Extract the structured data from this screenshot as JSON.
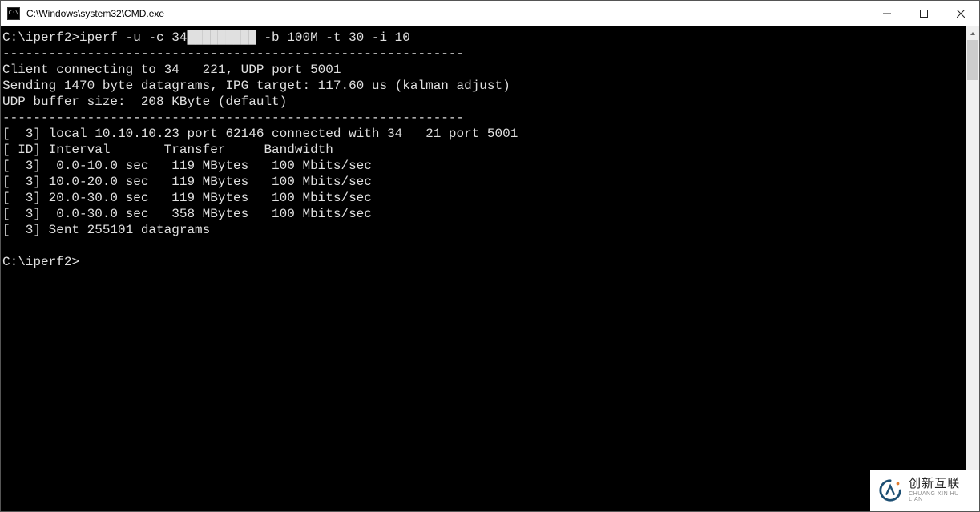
{
  "window": {
    "title": "C:\\Windows\\system32\\CMD.exe"
  },
  "terminal": {
    "prompt1": "C:\\iperf2>",
    "command": "iperf -u -c 34█████████ -b 100M -t 30 -i 10",
    "sep": "------------------------------------------------------------",
    "line_connecting_a": "Client connecting to 34",
    "line_connecting_b": "221, UDP port 5001",
    "line_sending": "Sending 1470 byte datagrams, IPG target: 117.60 us (kalman adjust)",
    "line_buffer": "UDP buffer size:  208 KByte (default)",
    "line_local_a": "[  3] local 10.10.10.23 port 62146 connected with 34",
    "line_local_b": "21 port 5001",
    "header": "[ ID] Interval       Transfer     Bandwidth",
    "rows": [
      "[  3]  0.0-10.0 sec   119 MBytes   100 Mbits/sec",
      "[  3] 10.0-20.0 sec   119 MBytes   100 Mbits/sec",
      "[  3] 20.0-30.0 sec   119 MBytes   100 Mbits/sec",
      "[  3]  0.0-30.0 sec   358 MBytes   100 Mbits/sec"
    ],
    "sent": "[  3] Sent 255101 datagrams",
    "prompt2": "C:\\iperf2>"
  },
  "watermark": {
    "cn": "创新互联",
    "en": "CHUANG XIN HU LIAN"
  }
}
